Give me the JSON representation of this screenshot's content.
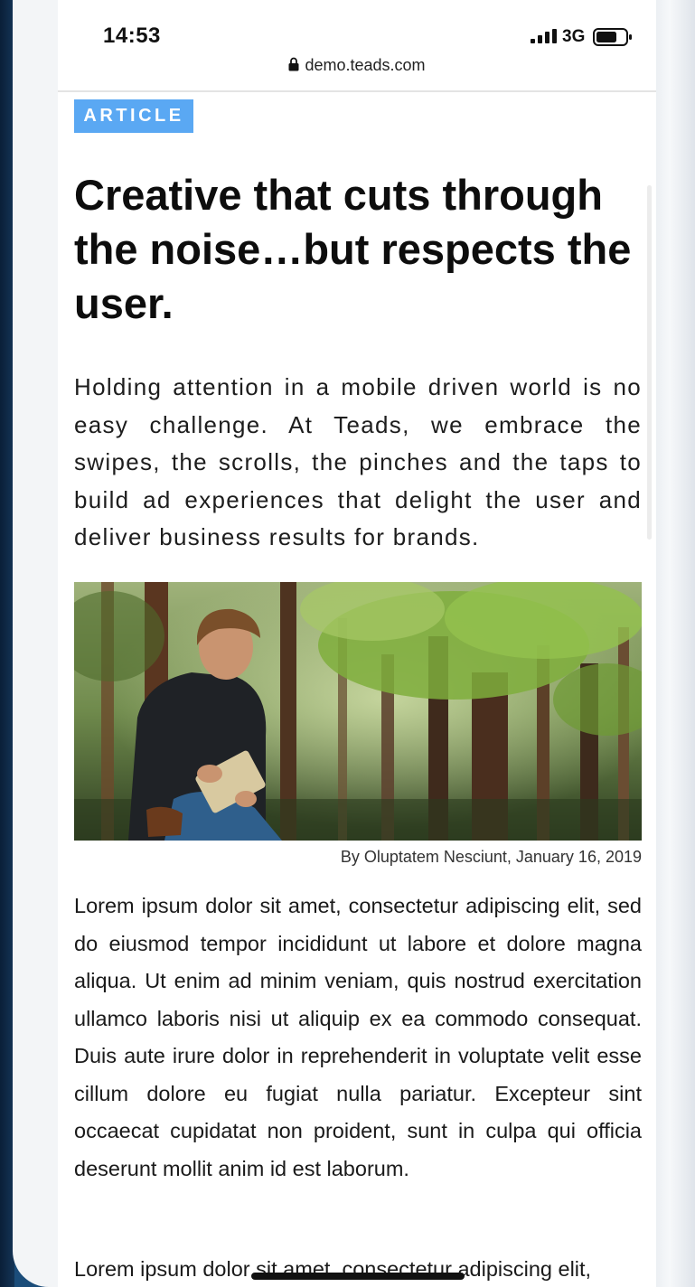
{
  "status_bar": {
    "time": "14:53",
    "network": "3G"
  },
  "browser": {
    "url": "demo.teads.com"
  },
  "article": {
    "badge": "ARTICLE",
    "headline": "Creative that cuts through the noise…but respects the user.",
    "lead": "Holding attention in a mobile driven world is no easy challenge. At Teads, we embrace the swipes, the scrolls, the pinches and the taps to build ad experiences that delight the user and deliver business results for brands.",
    "caption": "By Oluptatem Nesciunt, January 16, 2019",
    "body_paragraphs": [
      "Lorem ipsum dolor sit amet, consectetur adipiscing elit, sed do eiusmod tempor incididunt ut labore et dolore magna aliqua. Ut enim ad minim veniam, quis nostrud exercitation ullamco laboris nisi ut aliquip ex ea commodo consequat. Duis aute irure dolor in reprehenderit in voluptate velit esse cillum dolore eu fugiat nulla pariatur. Excepteur sint occaecat cupidatat non proident, sunt in culpa qui officia deserunt mollit anim id est laborum.",
      "Lorem ipsum dolor sit amet, consectetur adipiscing elit,"
    ]
  },
  "icons": {
    "signal": "signal-bars-icon",
    "battery": "battery-icon",
    "lock": "lock-icon"
  },
  "colors": {
    "badge_bg": "#5aa8f3",
    "headline": "#0d0d0d",
    "body": "#1a1a1a"
  }
}
